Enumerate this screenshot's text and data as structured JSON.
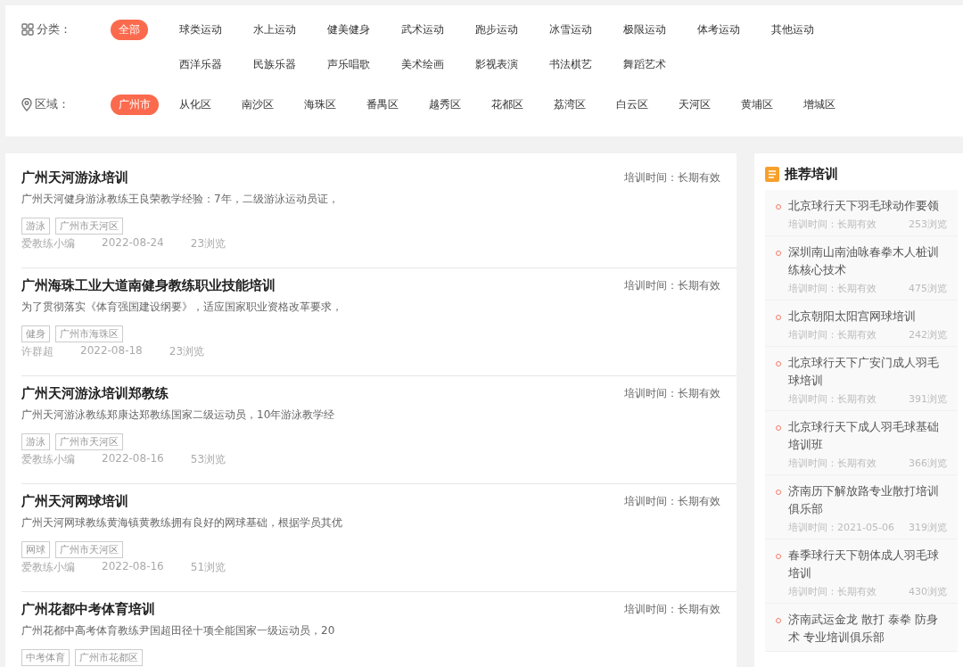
{
  "filters": [
    {
      "kind": "category",
      "label": "分类：",
      "options": [
        {
          "label": "全部",
          "selected": true
        },
        {
          "label": "球类运动",
          "selected": false
        },
        {
          "label": "水上运动",
          "selected": false
        },
        {
          "label": "健美健身",
          "selected": false
        },
        {
          "label": "武术运动",
          "selected": false
        },
        {
          "label": "跑步运动",
          "selected": false
        },
        {
          "label": "冰雪运动",
          "selected": false
        },
        {
          "label": "极限运动",
          "selected": false
        },
        {
          "label": "体考运动",
          "selected": false
        },
        {
          "label": "其他运动",
          "selected": false
        },
        {
          "label": "西洋乐器",
          "selected": false
        },
        {
          "label": "民族乐器",
          "selected": false
        },
        {
          "label": "声乐唱歌",
          "selected": false
        },
        {
          "label": "美术绘画",
          "selected": false
        },
        {
          "label": "影视表演",
          "selected": false
        },
        {
          "label": "书法棋艺",
          "selected": false
        },
        {
          "label": "舞蹈艺术",
          "selected": false
        }
      ]
    },
    {
      "kind": "region",
      "label": "区域：",
      "options": [
        {
          "label": "广州市",
          "selected": true
        },
        {
          "label": "从化区",
          "selected": false
        },
        {
          "label": "南沙区",
          "selected": false
        },
        {
          "label": "海珠区",
          "selected": false
        },
        {
          "label": "番禺区",
          "selected": false
        },
        {
          "label": "越秀区",
          "selected": false
        },
        {
          "label": "花都区",
          "selected": false
        },
        {
          "label": "荔湾区",
          "selected": false
        },
        {
          "label": "白云区",
          "selected": false
        },
        {
          "label": "天河区",
          "selected": false
        },
        {
          "label": "黄埔区",
          "selected": false
        },
        {
          "label": "增城区",
          "selected": false
        }
      ]
    }
  ],
  "trainings": [
    {
      "title": "广州天河游泳培训",
      "time": "培训时间：长期有效",
      "description": "广州天河健身游泳教练王良荣教学经验：7年，二级游泳运动员证，",
      "tags": [
        "游泳",
        "广州市天河区"
      ],
      "author": "爱教练小编",
      "date": "2022-08-24",
      "views": "23浏览"
    },
    {
      "title": "广州海珠工业大道南健身教练职业技能培训",
      "time": "培训时间：长期有效",
      "description": "为了贯彻落实《体育强国建设纲要》，适应国家职业资格改革要求，",
      "tags": [
        "健身",
        "广州市海珠区"
      ],
      "author": "许群超",
      "date": "2022-08-18",
      "views": "23浏览"
    },
    {
      "title": "广州天河游泳培训郑教练",
      "time": "培训时间：长期有效",
      "description": "广州天河游泳教练郑康达郑教练国家二级运动员，10年游泳教学经",
      "tags": [
        "游泳",
        "广州市天河区"
      ],
      "author": "爱教练小编",
      "date": "2022-08-16",
      "views": "53浏览"
    },
    {
      "title": "广州天河网球培训",
      "time": "培训时间：长期有效",
      "description": "广州天河网球教练黄海镇黄教练拥有良好的网球基础，根据学员其优",
      "tags": [
        "网球",
        "广州市天河区"
      ],
      "author": "爱教练小编",
      "date": "2022-08-16",
      "views": "51浏览"
    },
    {
      "title": "广州花都中考体育培训",
      "time": "培训时间：长期有效",
      "description": "广州花都中高考体育教练尹国超田径十项全能国家一级运动员，20",
      "tags": [
        "中考体育",
        "广州市花都区"
      ]
    }
  ],
  "recommended": {
    "title": "推荐培训",
    "items": [
      {
        "title": "北京球行天下羽毛球动作要领",
        "time": "培训时间：长期有效",
        "views": "253浏览"
      },
      {
        "title": "深圳南山南油咏春拳木人桩训练核心技术",
        "time": "培训时间：长期有效",
        "views": "475浏览"
      },
      {
        "title": "北京朝阳太阳宫网球培训",
        "time": "培训时间：长期有效",
        "views": "242浏览"
      },
      {
        "title": "北京球行天下广安门成人羽毛球培训",
        "time": "培训时间：长期有效",
        "views": "391浏览"
      },
      {
        "title": "北京球行天下成人羽毛球基础培训班",
        "time": "培训时间：长期有效",
        "views": "366浏览"
      },
      {
        "title": "济南历下解放路专业散打培训俱乐部",
        "time": "培训时间：2021-05-06",
        "views": "319浏览"
      },
      {
        "title": "春季球行天下朝体成人羽毛球培训",
        "time": "培训时间：长期有效",
        "views": "430浏览"
      },
      {
        "title": "济南武运金龙 散打 泰拳 防身术 专业培训俱乐部"
      }
    ]
  }
}
